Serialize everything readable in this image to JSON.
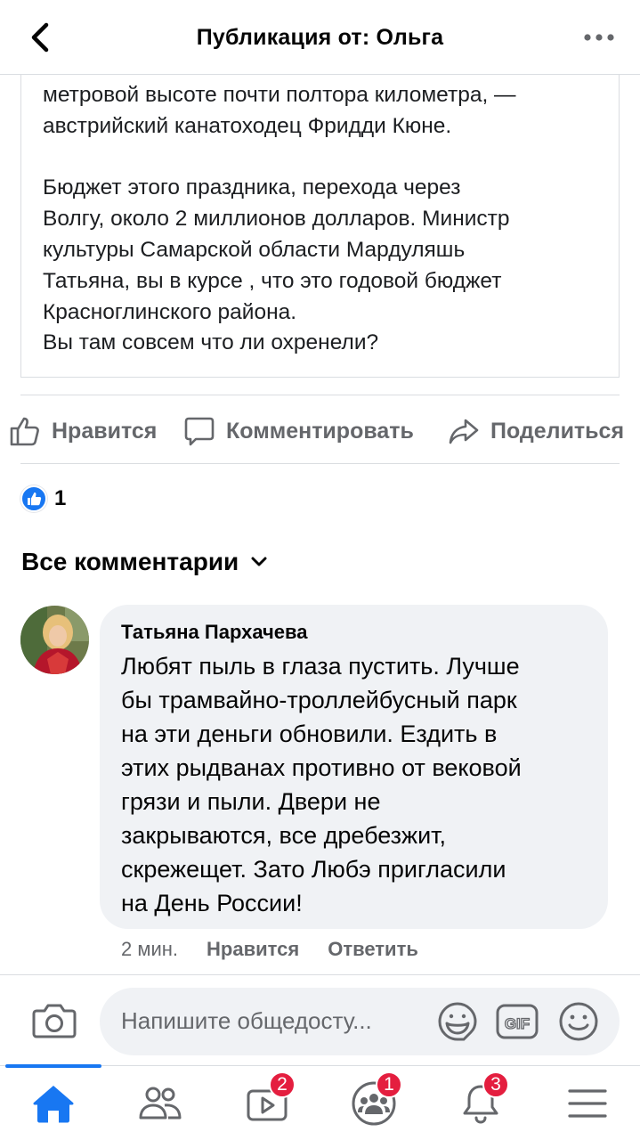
{
  "header": {
    "title": "Публикация от: Ольга"
  },
  "post": {
    "lines_para1": [
      "метровой высоте почти полтора километра, —",
      "австрийский канатоходец Фридди Кюне."
    ],
    "lines_para2": [
      "Бюджет этого праздника, перехода через",
      "Волгу, около 2 миллионов долларов. Министр",
      "культуры Самарской области Мардуляшь",
      "Татьяна, вы в курсе , что это годовой бюджет",
      "Красноглинского района.",
      "Вы там совсем что ли охренели?"
    ]
  },
  "actions": {
    "like": "Нравится",
    "comment": "Комментировать",
    "share": "Поделиться"
  },
  "reactions": {
    "count": "1"
  },
  "comments_section": {
    "filter_label": "Все комментарии"
  },
  "comment": {
    "author": "Татьяна Пархачева",
    "lines": [
      "Любят пыль в глаза пустить. Лучше",
      "бы трамвайно-троллейбусный парк",
      "на эти деньги обновили. Ездить в",
      "этих рыдванах противно от вековой",
      "грязи и пыли. Двери не",
      "закрываются, все дребезжит,",
      "скрежещет. Зато Любэ пригласили",
      "на День России!"
    ],
    "time": "2 мин.",
    "like": "Нравится",
    "reply": "Ответить"
  },
  "composer": {
    "placeholder": "Напишите общедосту..."
  },
  "nav": {
    "watch_badge": "2",
    "groups_badge": "1",
    "notifications_badge": "3"
  },
  "colors": {
    "accent": "#1877f2",
    "badge": "#e41e3f",
    "secondary_text": "#65676b",
    "bubble": "#f0f2f5"
  }
}
